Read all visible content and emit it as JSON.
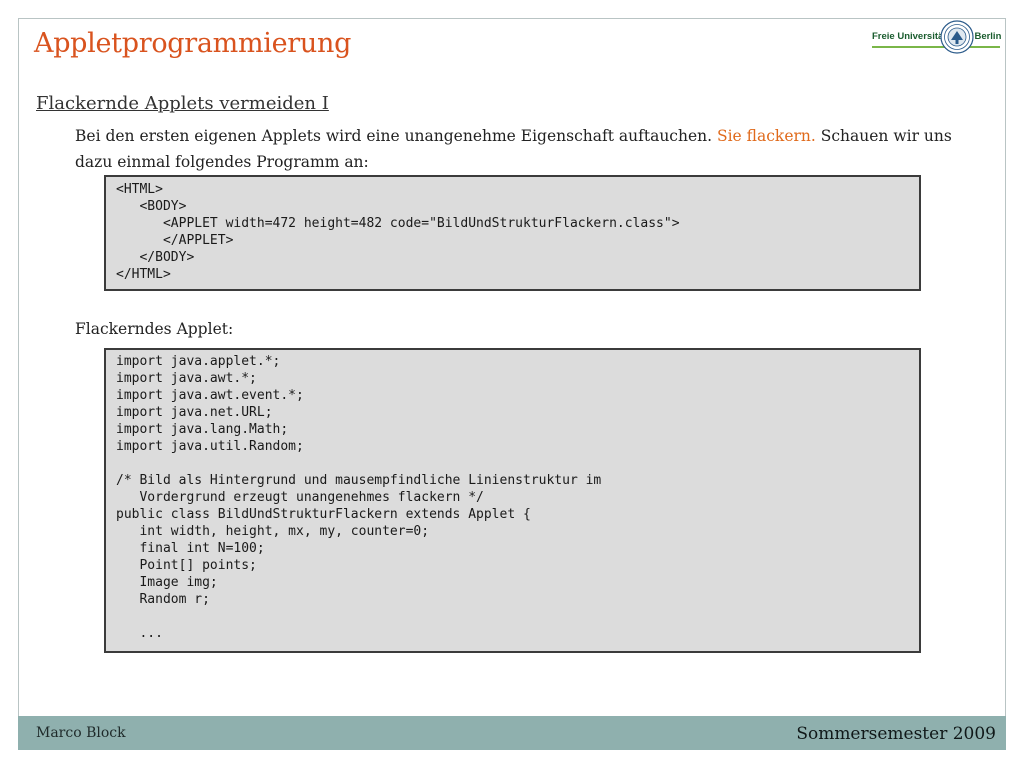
{
  "slide": {
    "title": "Appletprogrammierung",
    "logo": {
      "text_1": "Freie Universität",
      "text_2": "Berlin"
    },
    "section_heading": "Flackernde Applets vermeiden I",
    "intro": {
      "part1": "Bei den ersten eigenen Applets wird eine unangenehme Eigenschaft auftauchen.",
      "highlight": "Sie flackern.",
      "part2": "Schauen wir uns dazu einmal folgendes Programm an:"
    },
    "html_code": [
      "<HTML>",
      "   <BODY>",
      "      <APPLET width=472 height=482 code=\"BildUndStrukturFlackern.class\">",
      "      </APPLET>",
      "   </BODY>",
      "</HTML>"
    ],
    "caption": "Flackerndes Applet:",
    "java_code": [
      "import java.applet.*;",
      "import java.awt.*;",
      "import java.awt.event.*;",
      "import java.net.URL;",
      "import java.lang.Math;",
      "import java.util.Random;",
      "",
      "/* Bild als Hintergrund und mausempfindliche Linienstruktur im",
      "   Vordergrund erzeugt unangenehmes flackern */",
      "public class BildUndStrukturFlackern extends Applet {",
      "   int width, height, mx, my, counter=0;",
      "   final int N=100;",
      "   Point[] points;",
      "   Image img;",
      "   Random r;",
      "",
      "   ..."
    ]
  },
  "footer": {
    "author": "Marco Block",
    "semester": "Sommersemester 2009"
  },
  "colors": {
    "title": "#d9531e",
    "highlight": "#e06a1b",
    "footer_bar": "#8fb0ae",
    "code_background": "#dcdcdc"
  }
}
